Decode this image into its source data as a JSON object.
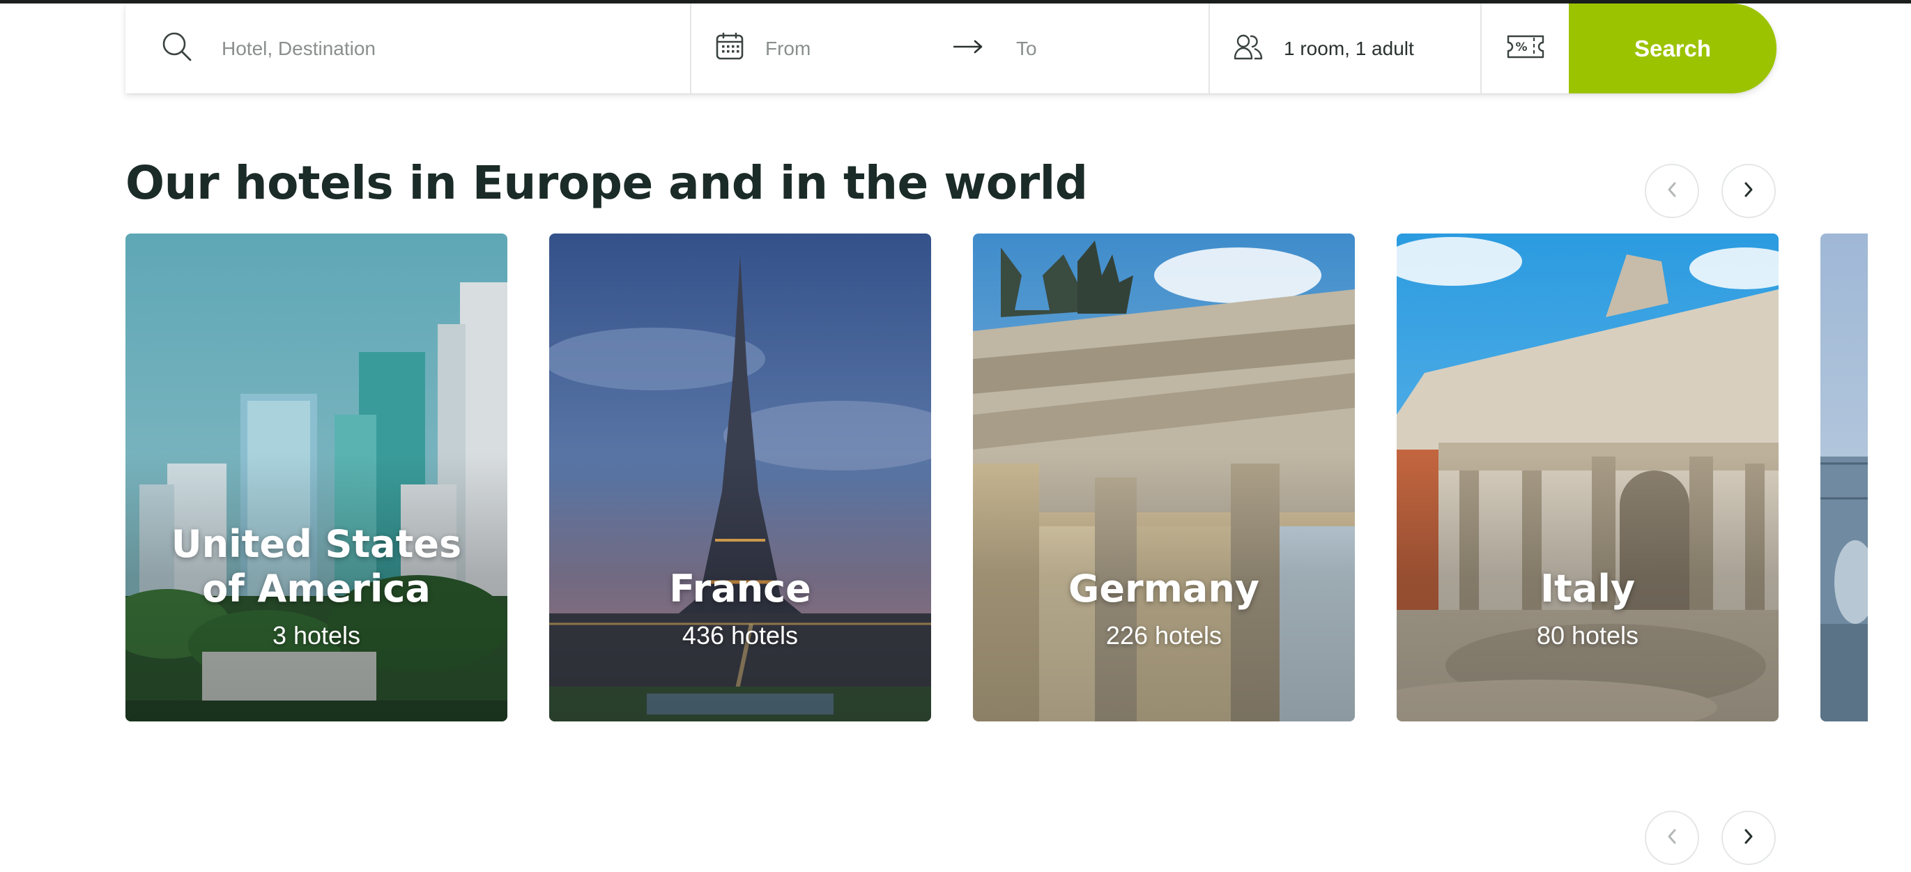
{
  "search_bar": {
    "destination_placeholder": "Hotel, Destination",
    "date_from": "From",
    "date_to": "To",
    "guests": "1 room, 1 adult",
    "search_label": "Search",
    "accent_color": "#9cc300"
  },
  "section": {
    "title": "Our hotels in Europe and in the world"
  },
  "destinations": [
    {
      "name": "United States of America",
      "count": "3 hotels"
    },
    {
      "name": "France",
      "count": "436 hotels"
    },
    {
      "name": "Germany",
      "count": "226 hotels"
    },
    {
      "name": "Italy",
      "count": "80 hotels"
    }
  ],
  "icons": {
    "search": "search-icon",
    "calendar": "calendar-icon",
    "arrow": "arrow-right-icon",
    "guests": "users-icon",
    "promo": "promo-ticket-icon",
    "prev": "chevron-left-icon",
    "next": "chevron-right-icon"
  }
}
